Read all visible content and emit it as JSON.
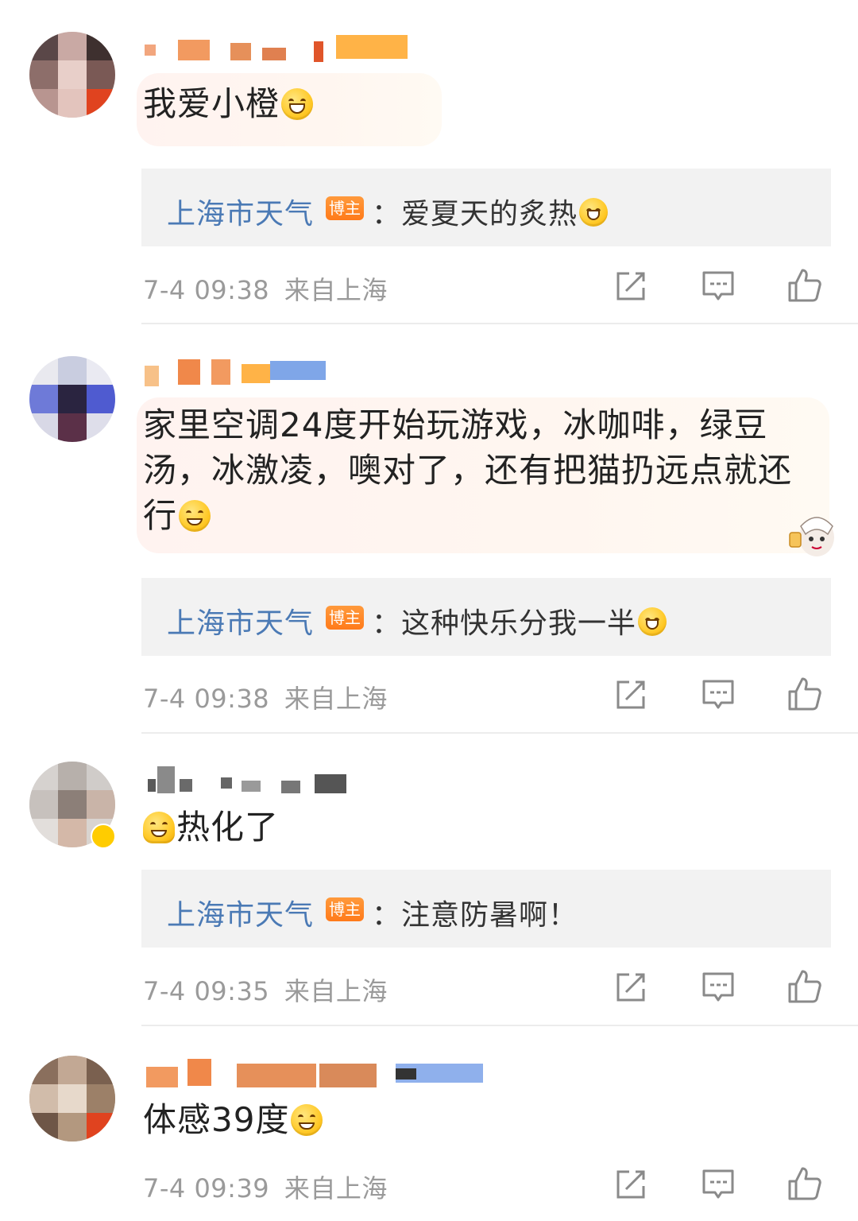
{
  "comments": [
    {
      "text": "我爱小橙",
      "reply": {
        "author": "上海市天气",
        "badge": "博主",
        "text": "：爱夏天的炙热"
      },
      "time": "7-4 09:38",
      "location": "来自上海"
    },
    {
      "text_line1": "家里空调24度开始玩游戏，冰咖啡，绿豆",
      "text_line2": "汤，冰激凌，噢对了，还有把猫扔远点就还",
      "text_line3": "行",
      "reply": {
        "author": "上海市天气",
        "badge": "博主",
        "text": "：这种快乐分我一半"
      },
      "time": "7-4 09:38",
      "location": "来自上海"
    },
    {
      "text": "热化了",
      "reply": {
        "author": "上海市天气",
        "badge": "博主",
        "text": "：注意防暑啊！"
      },
      "time": "7-4 09:35",
      "location": "来自上海"
    },
    {
      "text": "体感39度",
      "time": "7-4 09:39",
      "location": "来自上海"
    }
  ],
  "icons": {
    "share": "share-icon",
    "comment": "comment-icon",
    "like": "thumbs-up-icon"
  },
  "colors": {
    "author_link": "#4b7ab5",
    "badge": "#ff7a1a",
    "meta": "#9a9a9a"
  }
}
